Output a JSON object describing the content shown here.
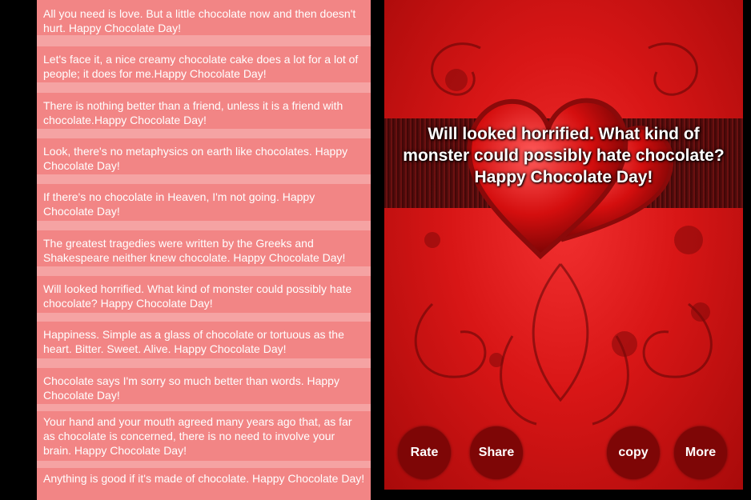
{
  "list": {
    "quotes": [
      "All you need is love. But a little chocolate now and then doesn't hurt. Happy Chocolate Day!",
      "Let's face it, a nice creamy chocolate cake does a lot for a lot of people; it does for me.Happy Chocolate Day!",
      "There is nothing better than a friend, unless it is a friend with chocolate.Happy Chocolate Day!",
      "Look, there's no metaphysics on earth like chocolates. Happy Chocolate Day!",
      "If there's no chocolate in Heaven, I'm not going. Happy Chocolate Day!",
      "The greatest tragedies were written by the Greeks and Shakespeare neither knew chocolate. Happy Chocolate Day!",
      "Will looked horrified. What kind of monster could possibly hate chocolate? Happy Chocolate Day!",
      "Happiness. Simple as a glass of chocolate or tortuous as the heart. Bitter. Sweet. Alive. Happy Chocolate Day!",
      "Chocolate says  I'm sorry so much better than words. Happy Chocolate Day!",
      "Your hand and your mouth agreed many years ago that, as far as chocolate is concerned, there is no need to involve your brain. Happy Chocolate Day!",
      "Anything is good if it's made of chocolate. Happy Chocolate Day!"
    ]
  },
  "detail": {
    "quote": "Will looked horrified. What kind of monster could possibly hate chocolate? Happy Chocolate Day!",
    "rate_label": "Rate",
    "share_label": "Share",
    "copy_label": "copy",
    "more_label": "More"
  },
  "colors": {
    "list_item_bg": "#f28585",
    "list_bg": "#f5a3a3",
    "button_bg": "#7e0606",
    "detail_bg": "#d81616"
  }
}
